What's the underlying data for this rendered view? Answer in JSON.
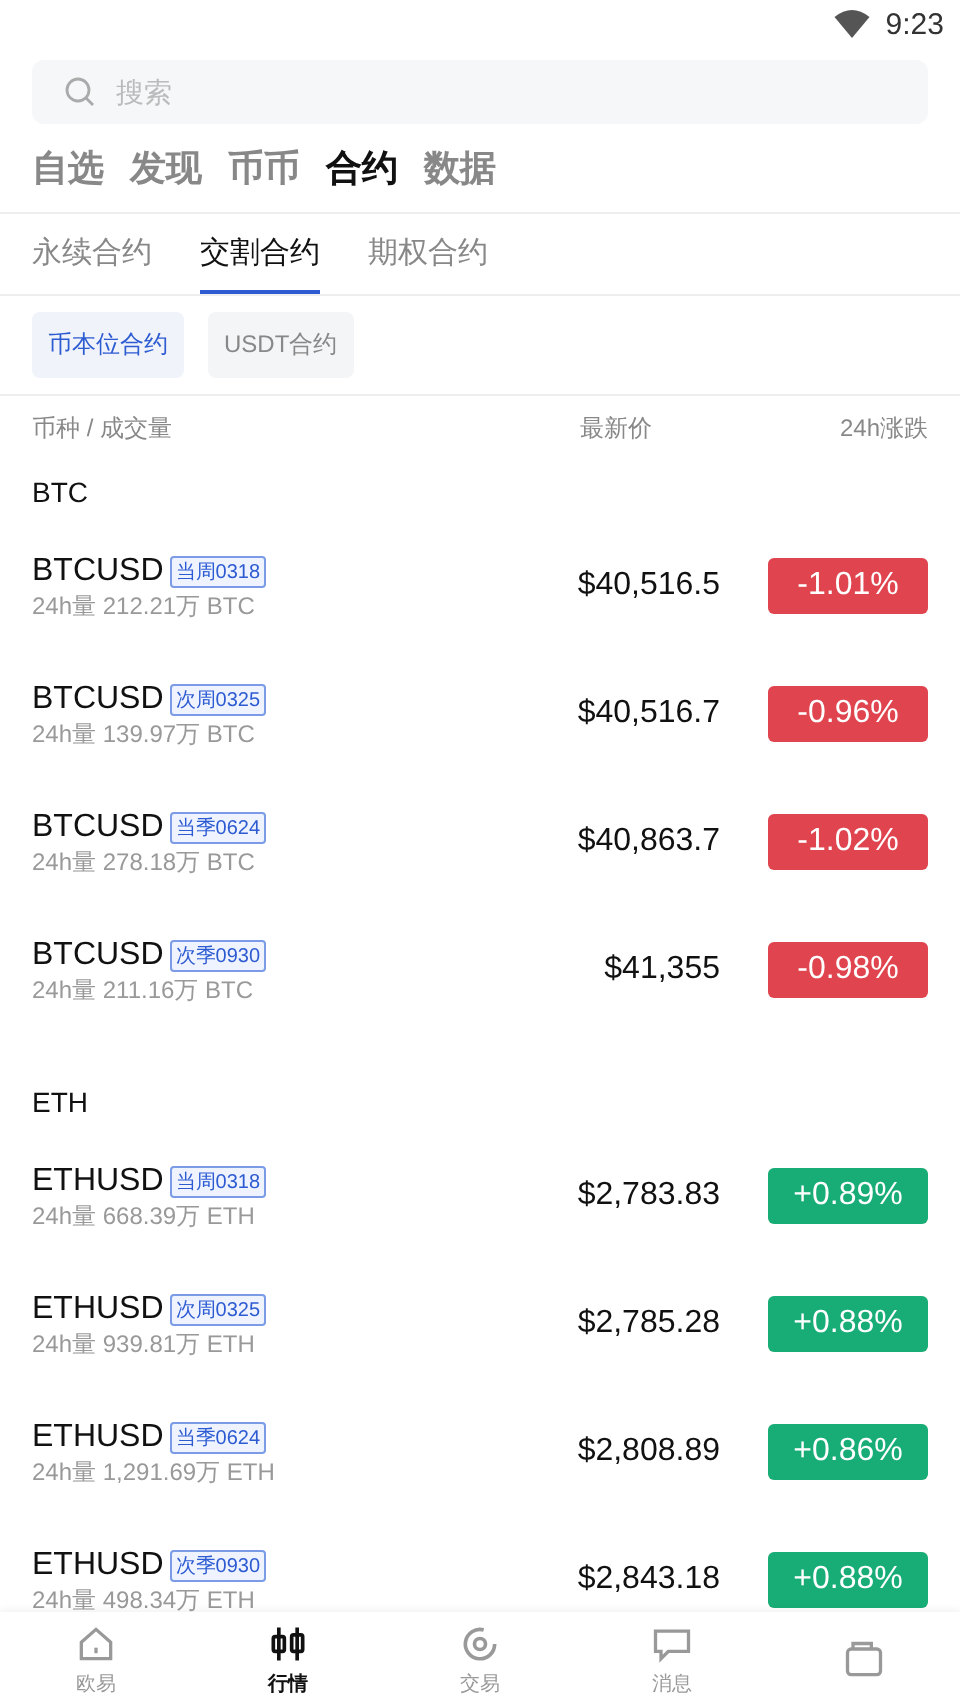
{
  "status_bar": {
    "time": "9:23"
  },
  "search": {
    "placeholder": "搜索"
  },
  "main_tabs": [
    {
      "label": "自选",
      "selected": false
    },
    {
      "label": "发现",
      "selected": false
    },
    {
      "label": "币币",
      "selected": false
    },
    {
      "label": "合约",
      "selected": true
    },
    {
      "label": "数据",
      "selected": false
    }
  ],
  "sub_tabs": [
    {
      "label": "永续合约",
      "selected": false
    },
    {
      "label": "交割合约",
      "selected": true
    },
    {
      "label": "期权合约",
      "selected": false
    }
  ],
  "chips": [
    {
      "label": "币本位合约",
      "selected": true
    },
    {
      "label": "USDT合约",
      "selected": false
    }
  ],
  "table_header": {
    "column_1": "币种 / 成交量",
    "column_2": "最新价",
    "column_3": "24h涨跌"
  },
  "groups": [
    {
      "label": "BTC",
      "rows": [
        {
          "symbol": "BTCUSD",
          "tag": "当周0318",
          "volume": "24h量 212.21万 BTC",
          "price": "$40,516.5",
          "change": "-1.01%",
          "color": "#e0454f"
        },
        {
          "symbol": "BTCUSD",
          "tag": "次周0325",
          "volume": "24h量 139.97万 BTC",
          "price": "$40,516.7",
          "change": "-0.96%",
          "color": "#e0454f"
        },
        {
          "symbol": "BTCUSD",
          "tag": "当季0624",
          "volume": "24h量 278.18万 BTC",
          "price": "$40,863.7",
          "change": "-1.02%",
          "color": "#e0454f"
        },
        {
          "symbol": "BTCUSD",
          "tag": "次季0930",
          "volume": "24h量 211.16万 BTC",
          "price": "$41,355",
          "change": "-0.98%",
          "color": "#e0454f"
        }
      ]
    },
    {
      "label": "ETH",
      "rows": [
        {
          "symbol": "ETHUSD",
          "tag": "当周0318",
          "volume": "24h量 668.39万 ETH",
          "price": "$2,783.83",
          "change": "+0.89%",
          "color": "#18ad77"
        },
        {
          "symbol": "ETHUSD",
          "tag": "次周0325",
          "volume": "24h量 939.81万 ETH",
          "price": "$2,785.28",
          "change": "+0.88%",
          "color": "#18ad77"
        },
        {
          "symbol": "ETHUSD",
          "tag": "当季0624",
          "volume": "24h量 1,291.69万 ETH",
          "price": "$2,808.89",
          "change": "+0.86%",
          "color": "#18ad77"
        },
        {
          "symbol": "ETHUSD",
          "tag": "次季0930",
          "volume": "24h量 498.34万 ETH",
          "price": "$2,843.18",
          "change": "+0.88%",
          "color": "#18ad77"
        }
      ]
    }
  ],
  "bottom_nav": [
    {
      "kind": "home",
      "label": "欧易",
      "selected": false
    },
    {
      "kind": "market",
      "label": "行情",
      "selected": true
    },
    {
      "kind": "trade",
      "label": "交易",
      "selected": false
    },
    {
      "kind": "message",
      "label": "消息",
      "selected": false
    },
    {
      "kind": "wallet",
      "selected": false
    }
  ]
}
